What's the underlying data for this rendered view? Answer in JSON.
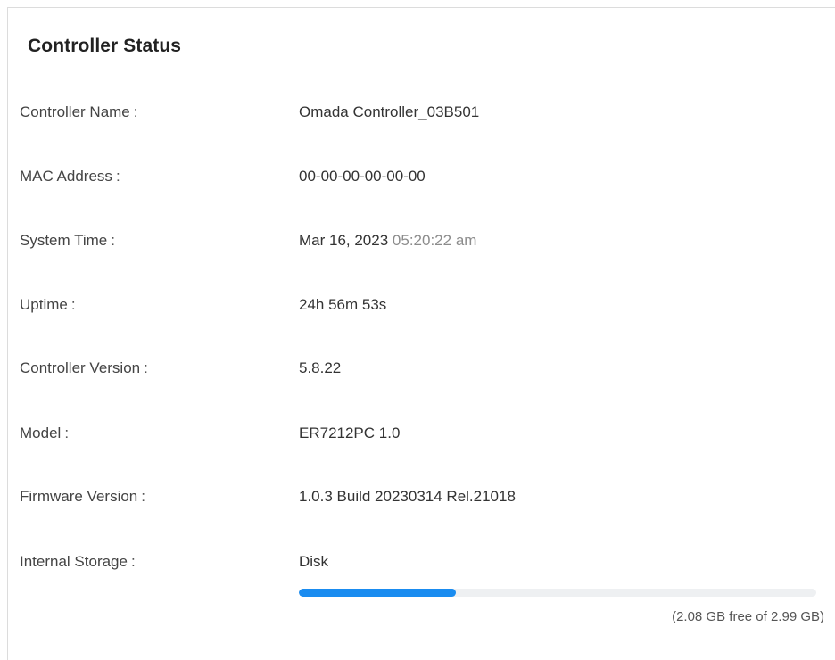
{
  "panel": {
    "title": "Controller Status"
  },
  "colon": ":",
  "rows": [
    {
      "label": "Controller Name",
      "value": "Omada Controller_03B501"
    },
    {
      "label": "MAC Address",
      "value": "00-00-00-00-00-00"
    },
    {
      "label": "System Time",
      "date": "Mar 16, 2023",
      "time": "05:20:22 am"
    },
    {
      "label": "Uptime",
      "value": "24h 56m 53s"
    },
    {
      "label": "Controller Version",
      "value": "5.8.22"
    },
    {
      "label": "Model",
      "value": "ER7212PC 1.0"
    },
    {
      "label": "Firmware Version",
      "value": "1.0.3 Build 20230314 Rel.21018"
    },
    {
      "label": "Internal Storage",
      "value": "Disk"
    }
  ],
  "storage": {
    "used_fraction": 0.304,
    "caption": "(2.08 GB free of 2.99 GB)",
    "bar_color": "#1a8cf0",
    "track_color": "#eef0f2"
  }
}
